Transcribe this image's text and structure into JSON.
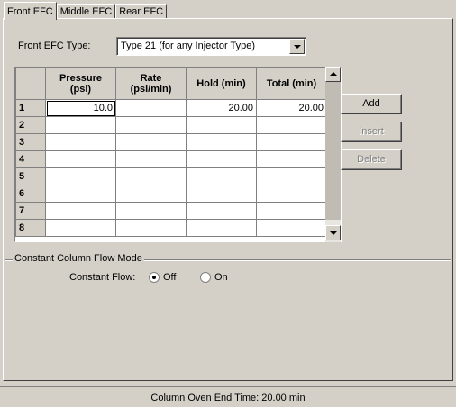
{
  "tabs": [
    {
      "label": "Front EFC",
      "active": true
    },
    {
      "label": "Middle EFC",
      "active": false
    },
    {
      "label": "Rear EFC",
      "active": false
    }
  ],
  "efc_type": {
    "label": "Front EFC Type:",
    "value": "Type 21 (for any Injector Type)",
    "icon": "chevron-down-icon"
  },
  "table": {
    "headers": [
      {
        "line1": "Pressure",
        "line2": "(psi)"
      },
      {
        "line1": "Rate",
        "line2": "(psi/min)"
      },
      {
        "line1": "Hold (min)",
        "line2": ""
      },
      {
        "line1": "Total (min)",
        "line2": ""
      }
    ],
    "rows": [
      {
        "num": "1",
        "cells": [
          "10.0",
          "",
          "20.00",
          "20.00"
        ]
      },
      {
        "num": "2",
        "cells": [
          "",
          "",
          "",
          ""
        ]
      },
      {
        "num": "3",
        "cells": [
          "",
          "",
          "",
          ""
        ]
      },
      {
        "num": "4",
        "cells": [
          "",
          "",
          "",
          ""
        ]
      },
      {
        "num": "5",
        "cells": [
          "",
          "",
          "",
          ""
        ]
      },
      {
        "num": "6",
        "cells": [
          "",
          "",
          "",
          ""
        ]
      },
      {
        "num": "7",
        "cells": [
          "",
          "",
          "",
          ""
        ]
      },
      {
        "num": "8",
        "cells": [
          "",
          "",
          "",
          ""
        ]
      }
    ]
  },
  "buttons": {
    "add": "Add",
    "insert": "Insert",
    "delete": "Delete"
  },
  "constant_flow": {
    "group_title": "Constant Column Flow Mode",
    "label": "Constant Flow:",
    "options": [
      {
        "label": "Off",
        "selected": true
      },
      {
        "label": "On",
        "selected": false
      }
    ]
  },
  "status": {
    "text": "Column Oven End Time:  20.00 min"
  },
  "colors": {
    "face": "#d4d0c8",
    "shadow": "#808080",
    "highlight": "#ffffff"
  }
}
